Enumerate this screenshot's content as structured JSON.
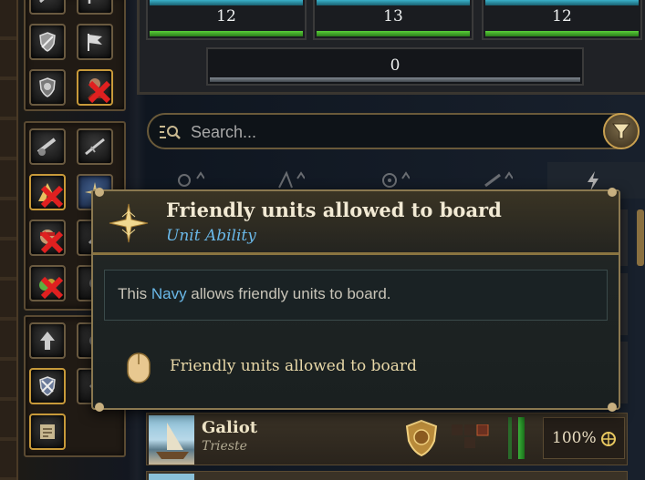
{
  "top_stats": [
    {
      "value": "12"
    },
    {
      "value": "13"
    },
    {
      "value": "12"
    }
  ],
  "top_stat_wide": {
    "value": "0"
  },
  "search": {
    "placeholder": "Search..."
  },
  "tooltip": {
    "title": "Friendly units allowed to board",
    "subtitle": "Unit Ability",
    "description_prefix": "This ",
    "description_keyword": "Navy",
    "description_suffix": " allows friendly units to board.",
    "requirement": "Friendly units allowed to board"
  },
  "unit_row": {
    "name": "Galiot",
    "location": "Trieste",
    "health_percent": "100%"
  },
  "colors": {
    "accent_gold": "#c8a050",
    "keyword_blue": "#6ab8e8",
    "health_green": "#3ab03a",
    "stat_cyan": "#3ab0c8"
  }
}
